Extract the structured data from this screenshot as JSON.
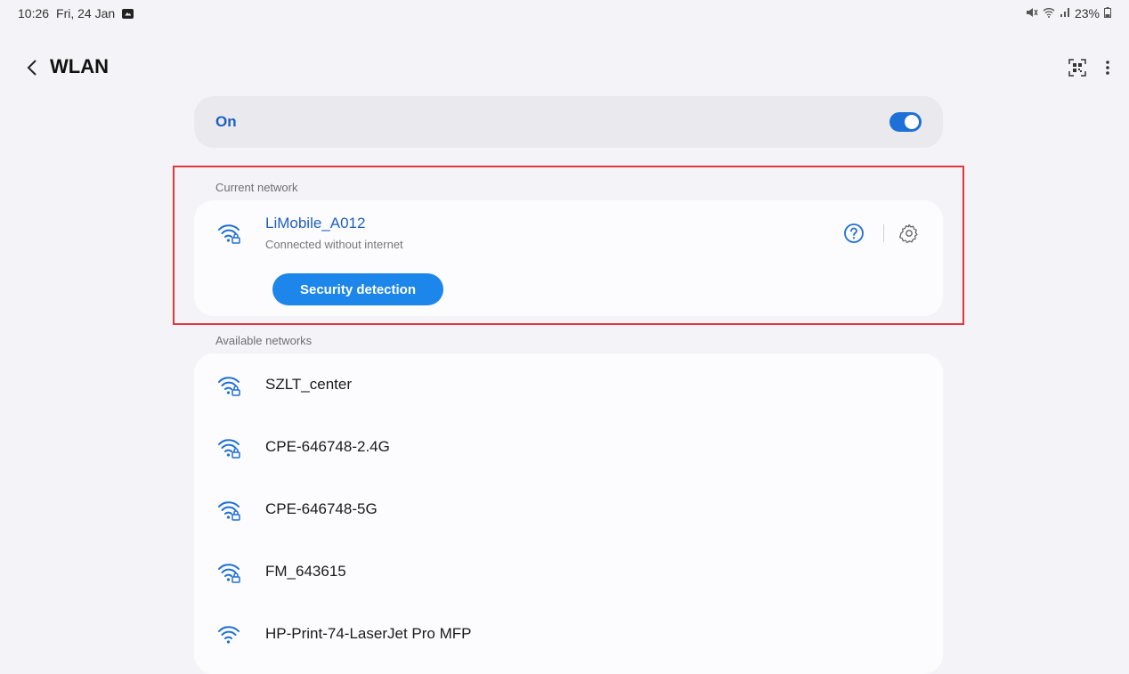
{
  "status_bar": {
    "time": "10:26",
    "date": "Fri, 24 Jan",
    "battery": "23%"
  },
  "header": {
    "title": "WLAN"
  },
  "wifi_toggle": {
    "label": "On",
    "state": true
  },
  "current_network": {
    "section_label": "Current network",
    "name": "LiMobile_A012",
    "status": "Connected without internet",
    "action_label": "Security detection"
  },
  "available_networks": {
    "section_label": "Available networks",
    "items": [
      {
        "name": "SZLT_center",
        "secured": true
      },
      {
        "name": "CPE-646748-2.4G",
        "secured": true
      },
      {
        "name": "CPE-646748-5G",
        "secured": true
      },
      {
        "name": "FM_643615",
        "secured": true
      },
      {
        "name": "HP-Print-74-LaserJet Pro MFP",
        "secured": false
      }
    ]
  },
  "colors": {
    "accent": "#1e70d8",
    "highlight": "#e0373d",
    "background": "#f4f4f8"
  }
}
